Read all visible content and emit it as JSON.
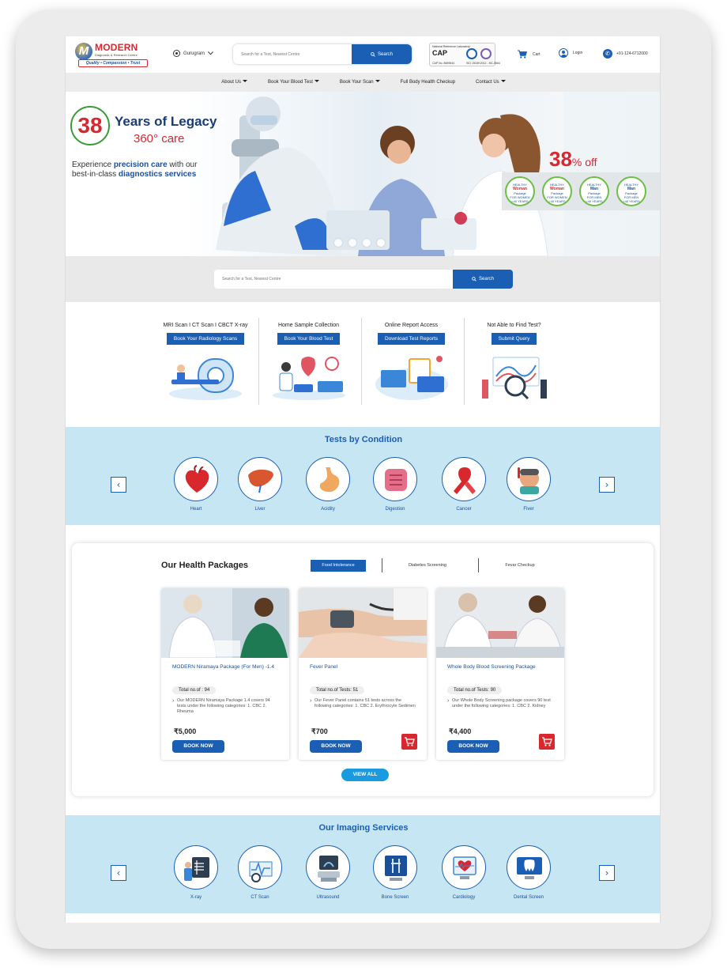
{
  "header": {
    "logo_name": "MODERN",
    "logo_sub": "Diagnostic & Research Centre",
    "logo_tagline": "Quality • Compassion • Trust",
    "location": "Gurugram",
    "search_placeholder": "Search for a Test, Nearest Centre",
    "search_button": "Search",
    "accreditation": {
      "top_text": "National Reference Laboratory",
      "logo_text": "CAP",
      "left_number": "CAP No. 8699544",
      "right_number": "ISO 15189:2012 - MC-5564"
    },
    "cart_label": "Cart",
    "login_label": "Login",
    "phone": "+91-124-6712000"
  },
  "nav": {
    "items": [
      {
        "label": "About Us",
        "dropdown": true
      },
      {
        "label": "Book Your Blood Test",
        "dropdown": true
      },
      {
        "label": "Book Your Scan",
        "dropdown": true
      },
      {
        "label": "Full Body Health Checkup",
        "dropdown": false
      },
      {
        "label": "Contact Us",
        "dropdown": true
      }
    ]
  },
  "hero": {
    "years_number": "38",
    "years_text": "Years of Legacy",
    "care_text": "360° care",
    "line1_plain": "Experience ",
    "line1_bold": "precision care",
    "line1_tail": " with our",
    "line2_plain": "best-in-class ",
    "line2_bold": "diagnostics services",
    "offer_number": "38",
    "offer_suffix": "% off",
    "badges": [
      {
        "top": "HEALTHY",
        "name": "Woman",
        "sub": "Package",
        "line1": "FOR WOMEN",
        "line2": "<40 YEARS"
      },
      {
        "top": "HEALTHY",
        "name": "Woman",
        "sub": "Package",
        "line1": "FOR WOMEN",
        "line2": ">40 YEARS"
      },
      {
        "top": "HEALTHY",
        "name": "Man",
        "sub": "Package",
        "line1": "FOR MEN",
        "line2": "<40 YEARS"
      },
      {
        "top": "HEALTHY",
        "name": "Man",
        "sub": "Package",
        "line1": "FOR MEN",
        "line2": ">40 YEARS"
      }
    ],
    "slide_count": 4,
    "active_slide": 4
  },
  "mid_search": {
    "placeholder": "Search for a Test, Nearest Centre",
    "button": "Search"
  },
  "services": [
    {
      "title": "MRI Scan I CT Scan I CBCT X-ray",
      "button": "Book Your Radiology Scans",
      "icon": "mri-scanner-illustration"
    },
    {
      "title": "Home Sample Collection",
      "button": "Book Your Blood Test",
      "icon": "blood-test-illustration"
    },
    {
      "title": "Online Report Access",
      "button": "Download Test Reports",
      "icon": "online-report-illustration"
    },
    {
      "title": "Not Able to Find Test?",
      "button": "Submit Query",
      "icon": "search-test-illustration"
    }
  ],
  "conditions": {
    "title": "Tests by Condition",
    "items": [
      {
        "label": "Heart",
        "icon": "heart-icon"
      },
      {
        "label": "Liver",
        "icon": "liver-icon"
      },
      {
        "label": "Acidity",
        "icon": "stomach-icon"
      },
      {
        "label": "Digestion",
        "icon": "intestine-icon"
      },
      {
        "label": "Cancer",
        "icon": "cancer-ribbon-icon"
      },
      {
        "label": "Fiver",
        "icon": "fever-icon"
      }
    ]
  },
  "packages": {
    "title": "Our Health Packages",
    "tabs": [
      {
        "label": "Food Intolerance",
        "active": true
      },
      {
        "label": "Diabetes Screening",
        "active": false
      },
      {
        "label": "Fevar Checkup",
        "active": false
      }
    ],
    "cards": [
      {
        "name": "MODERN Niramaya Package (For Men) -1.4",
        "tests": "Total no.of : 94",
        "desc": "Our MODERN Niramaya Package 1.4 covers 94 tests under the following categories: 1. CBC 2. Rheuma",
        "price": "₹5,000",
        "book": "BOOK NOW",
        "cart": false
      },
      {
        "name": "Fever Panel",
        "tests": "Total no.of Tests: 51",
        "desc": "Our Fever Panel contains 51 tests across the following categories: 1. CBC 2. Erythrocyte Sedimen",
        "price": "₹700",
        "book": "BOOK NOW",
        "cart": true
      },
      {
        "name": "Whole Body Blood Screening Package",
        "tests": "Total no.of Tests: 90",
        "desc": "Our Whole Body Screening package covers 90 test under the following categories: 1. CBC 2. Kidney",
        "price": "₹4,400",
        "book": "BOOK NOW",
        "cart": true
      }
    ],
    "view_all": "VIEW ALL"
  },
  "imaging": {
    "title": "Our Imaging Services",
    "items": [
      {
        "label": "X-ray",
        "icon": "xray-icon"
      },
      {
        "label": "CT Scan",
        "icon": "ct-scan-icon"
      },
      {
        "label": "Ultrasound",
        "icon": "ultrasound-icon"
      },
      {
        "label": "Bone Screen",
        "icon": "bone-screen-icon"
      },
      {
        "label": "Cardiology",
        "icon": "cardiology-icon"
      },
      {
        "label": "Dental Screen",
        "icon": "dental-icon"
      }
    ]
  },
  "colors": {
    "brand_blue": "#1a5fb4",
    "brand_red": "#d9272e",
    "light_blue_band": "#c6e6f4"
  }
}
